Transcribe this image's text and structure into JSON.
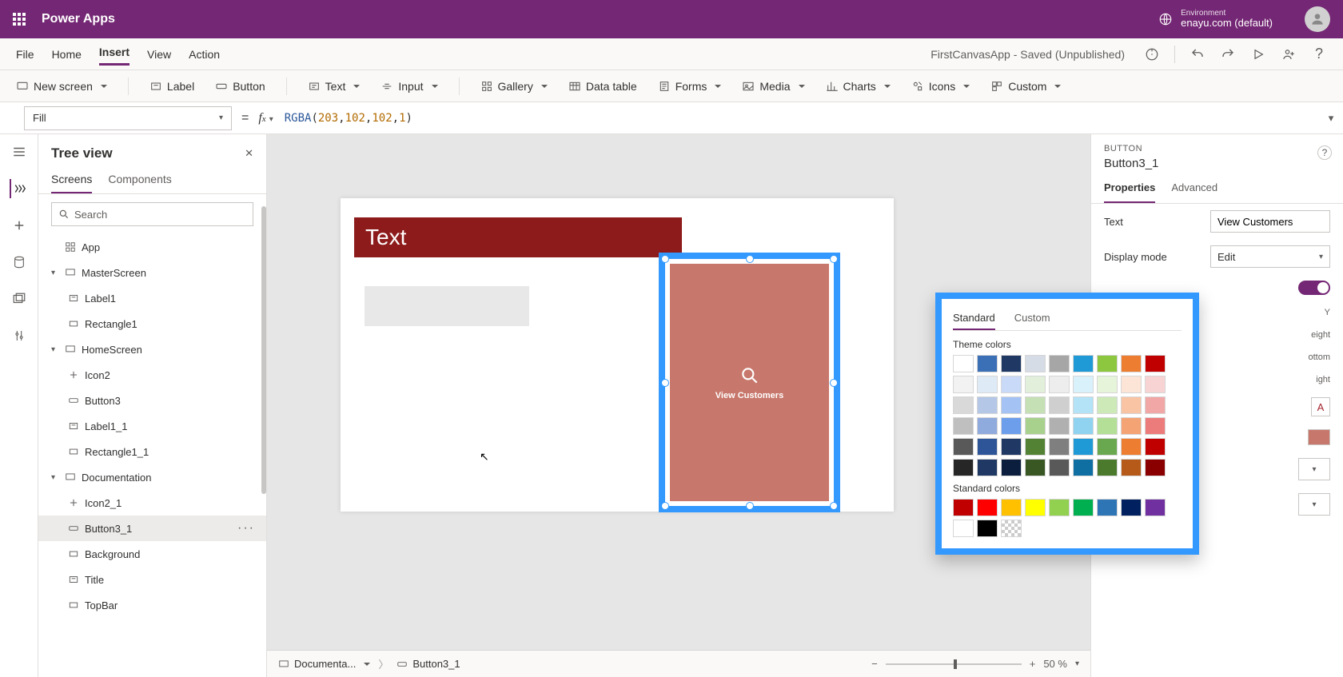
{
  "titlebar": {
    "app": "Power Apps",
    "env_label": "Environment",
    "env_name": "enayu.com (default)"
  },
  "menubar": {
    "items": [
      "File",
      "Home",
      "Insert",
      "View",
      "Action"
    ],
    "active": "Insert",
    "status": "FirstCanvasApp - Saved (Unpublished)"
  },
  "ribbon": {
    "newscreen": "New screen",
    "label": "Label",
    "button": "Button",
    "text": "Text",
    "input": "Input",
    "gallery": "Gallery",
    "datatable": "Data table",
    "forms": "Forms",
    "media": "Media",
    "charts": "Charts",
    "icons": "Icons",
    "custom": "Custom"
  },
  "formula": {
    "property": "Fill",
    "tokens": [
      "RGBA",
      "(",
      "203",
      ", ",
      "102",
      ", ",
      "102",
      ", ",
      "1",
      ")"
    ]
  },
  "tree": {
    "title": "Tree view",
    "tabs": [
      "Screens",
      "Components"
    ],
    "search_placeholder": "Search",
    "nodes": [
      {
        "depth": 1,
        "label": "App",
        "icon": "app"
      },
      {
        "depth": 1,
        "label": "MasterScreen",
        "icon": "screen",
        "caret": "v"
      },
      {
        "depth": 2,
        "label": "Label1",
        "icon": "label"
      },
      {
        "depth": 2,
        "label": "Rectangle1",
        "icon": "rect"
      },
      {
        "depth": 1,
        "label": "HomeScreen",
        "icon": "screen",
        "caret": "v"
      },
      {
        "depth": 2,
        "label": "Icon2",
        "icon": "plus"
      },
      {
        "depth": 2,
        "label": "Button3",
        "icon": "btn"
      },
      {
        "depth": 2,
        "label": "Label1_1",
        "icon": "label"
      },
      {
        "depth": 2,
        "label": "Rectangle1_1",
        "icon": "rect"
      },
      {
        "depth": 1,
        "label": "Documentation",
        "icon": "screen",
        "caret": "v"
      },
      {
        "depth": 2,
        "label": "Icon2_1",
        "icon": "plus"
      },
      {
        "depth": 2,
        "label": "Button3_1",
        "icon": "btn",
        "selected": true,
        "menu": true
      },
      {
        "depth": 2,
        "label": "Background",
        "icon": "rect"
      },
      {
        "depth": 2,
        "label": "Title",
        "icon": "label"
      },
      {
        "depth": 2,
        "label": "TopBar",
        "icon": "rect"
      }
    ]
  },
  "canvas": {
    "banner_text": "Text",
    "button_text": "View Customers",
    "crumb_screen": "Documenta...",
    "crumb_control": "Button3_1",
    "zoom": "50",
    "zoom_suffix": " %"
  },
  "props": {
    "type": "BUTTON",
    "name": "Button3_1",
    "tabs": [
      "Properties",
      "Advanced"
    ],
    "text_label": "Text",
    "text_value": "View Customers",
    "mode_label": "Display mode",
    "mode_value": "Edit",
    "partial_labels": [
      "Y",
      "eight",
      "ottom",
      "ight"
    ]
  },
  "picker": {
    "tabs": [
      "Standard",
      "Custom"
    ],
    "theme_label": "Theme colors",
    "std_label": "Standard colors",
    "theme_rows": [
      [
        "#ffffff",
        "#3b6fb6",
        "#1f3864",
        "#d6dce5",
        "#a6a6a6",
        "#1f9ad6",
        "#8dc63f",
        "#ed7d31",
        "#c00000"
      ],
      [
        "#f2f2f2",
        "#deebf7",
        "#c9daf8",
        "#e2efda",
        "#ededed",
        "#d9f1fb",
        "#e6f4d9",
        "#fce5d6",
        "#f8d3d3"
      ],
      [
        "#d9d9d9",
        "#b4c7e7",
        "#a4c2f4",
        "#c5e0b4",
        "#cfcfcf",
        "#b4e2f6",
        "#cde9b8",
        "#f8c4a3",
        "#f2a7a7"
      ],
      [
        "#bfbfbf",
        "#8faadc",
        "#6d9eeb",
        "#a9d18e",
        "#b0b0b0",
        "#8fd3f1",
        "#b4df97",
        "#f4a374",
        "#ec7b7b"
      ],
      [
        "#595959",
        "#2e5597",
        "#1f3864",
        "#548235",
        "#7f7f7f",
        "#1f9ad6",
        "#6aa84f",
        "#ed7d31",
        "#c00000"
      ],
      [
        "#262626",
        "#1f3864",
        "#0b1e3e",
        "#385723",
        "#595959",
        "#0f6fa3",
        "#4b7a2c",
        "#b55a18",
        "#8a0000"
      ]
    ],
    "standard_row": [
      "#c00000",
      "#ff0000",
      "#ffc000",
      "#ffff00",
      "#92d050",
      "#00b050",
      "#2e75b6",
      "#002060",
      "#7030a0"
    ],
    "extra_row": [
      "#ffffff",
      "#000000",
      "transparent"
    ]
  }
}
